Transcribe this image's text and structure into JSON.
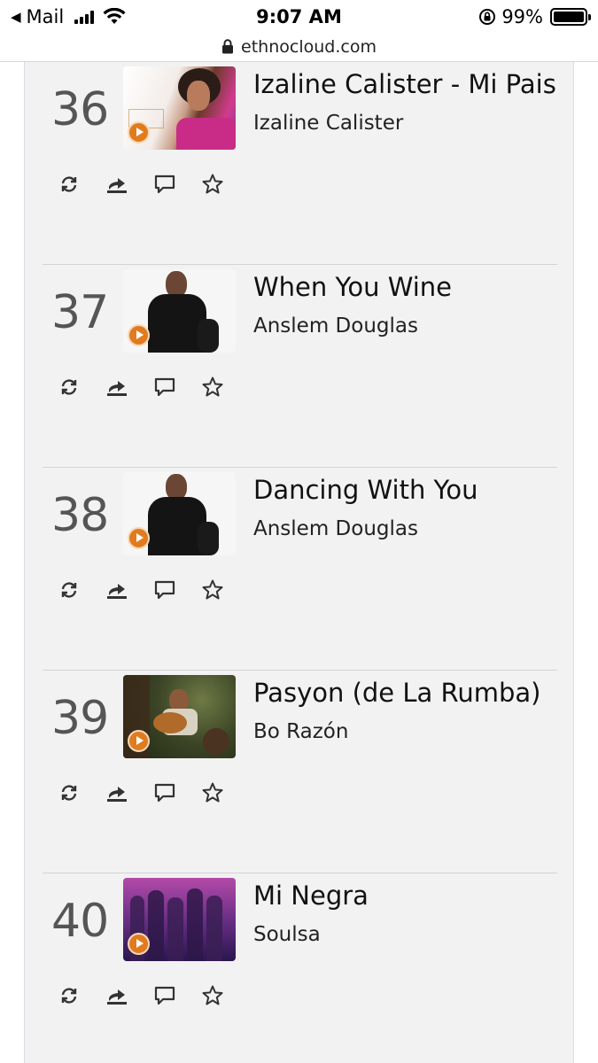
{
  "status_bar": {
    "back_app": "Mail",
    "time": "9:07 AM",
    "battery": "99%"
  },
  "url_bar": {
    "domain": "ethnocloud.com"
  },
  "tracks": [
    {
      "rank": "36",
      "title": "Izaline Calister - Mi Pais",
      "artist": "Izaline Calister"
    },
    {
      "rank": "37",
      "title": "When You Wine",
      "artist": "Anslem Douglas"
    },
    {
      "rank": "38",
      "title": "Dancing With You",
      "artist": "Anslem Douglas"
    },
    {
      "rank": "39",
      "title": "Pasyon (de La Rumba)",
      "artist": "Bo Razón"
    },
    {
      "rank": "40",
      "title": "Mi Negra",
      "artist": "Soulsa"
    }
  ],
  "track_actions": [
    "repost-icon",
    "share-icon",
    "comment-icon",
    "favorite-star-icon"
  ],
  "colors": {
    "play_button": "#e07b1f",
    "background": "#f2f2f2"
  }
}
